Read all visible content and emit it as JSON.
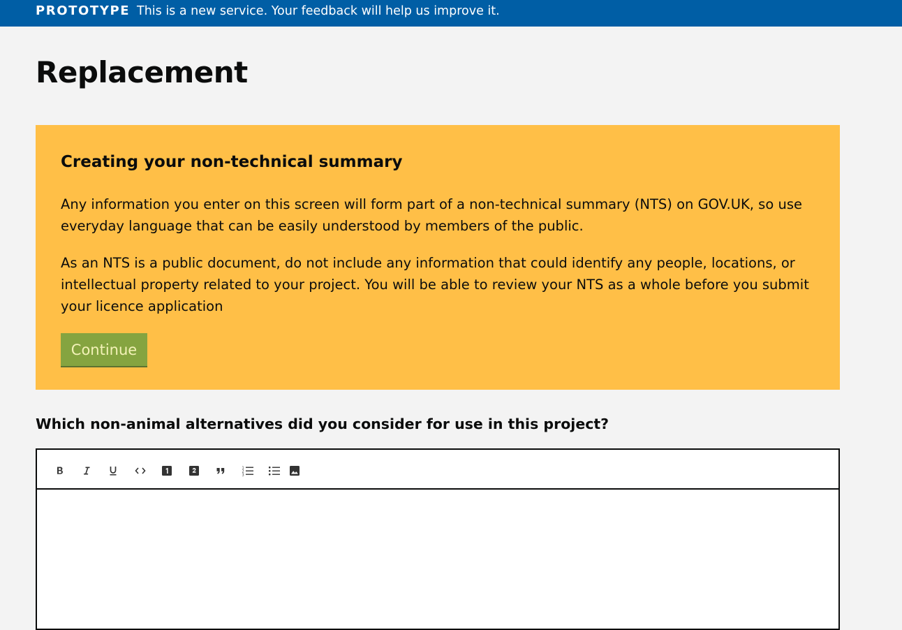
{
  "banner": {
    "tag": "PROTOTYPE",
    "message": "This is a new service. Your feedback will help us improve it.",
    "color": "#005ea5"
  },
  "page": {
    "title": "Replacement"
  },
  "notice": {
    "heading": "Creating your non-technical summary",
    "paragraph1": "Any information you enter on this screen will form part of a non-technical summary (NTS) on GOV.UK, so use everyday language that can be easily understood by members of the public.",
    "paragraph2": "As an NTS is a public document, do not include any information that could identify any people, locations, or intellectual property related to your project. You will be able to review your NTS as a whole before you submit your licence application",
    "continue_label": "Continue",
    "background": "#ffbf47",
    "button_color": "#85a440"
  },
  "question": {
    "label": "Which non-animal alternatives did you consider for use in this project?",
    "value": ""
  },
  "editor": {
    "toolbar": [
      {
        "name": "bold-icon",
        "label": "Bold"
      },
      {
        "name": "italic-icon",
        "label": "Italic"
      },
      {
        "name": "underline-icon",
        "label": "Underline"
      },
      {
        "name": "code-icon",
        "label": "Code"
      },
      {
        "name": "heading-one-icon",
        "label": "Heading 1"
      },
      {
        "name": "heading-two-icon",
        "label": "Heading 2"
      },
      {
        "name": "quote-icon",
        "label": "Block quote"
      },
      {
        "name": "numbered-list-icon",
        "label": "Numbered list"
      },
      {
        "name": "bulleted-list-icon",
        "label": "Bulleted list"
      },
      {
        "name": "image-icon",
        "label": "Image"
      }
    ]
  }
}
